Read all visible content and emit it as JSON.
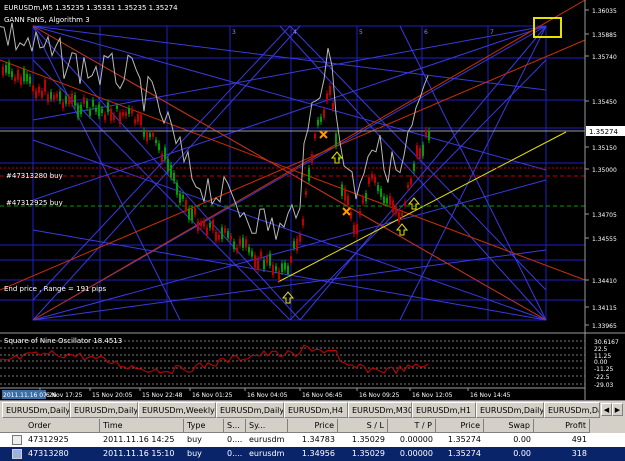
{
  "chart": {
    "header": "EURUSDm,M5  1.35235 1.35331 1.35235 1.35274",
    "indicator_name": "GANN FaNS, Algorithm 3",
    "current_price_label": "1.35274",
    "price_labels": [
      "1.36035",
      "1.35885",
      "1.35740",
      "1.35450",
      "1.35150",
      "1.35000",
      "1.34705",
      "1.34555",
      "1.34410",
      "1.34115",
      "1.33965"
    ],
    "top_numbers": [
      "3",
      "4",
      "5",
      "6",
      "7"
    ],
    "order_labels": [
      "#47313280 buy",
      "#47312925 buy"
    ],
    "end_price_label": "End price , Range = 191 pips",
    "time_labels": [
      "16 Nov 17:25",
      "15 Nov 20:05",
      "15 Nov 22:48",
      "16 Nov 01:25",
      "16 Nov 04:05",
      "16 Nov 06:45",
      "16 Nov 09:25",
      "16 Nov 12:05",
      "16 Nov 14:45"
    ],
    "date_marker": "2011.11.16 07:26",
    "colors": {
      "background": "#000000",
      "grid": "#2020c0",
      "gann_red": "#c83000",
      "trend_yellow": "#e8e000",
      "candle_up": "#00a000",
      "candle_down": "#c00000",
      "oscillator": "#d00000"
    }
  },
  "oscillator": {
    "title": "Square of Nine Oscillator 18.4513",
    "levels": [
      "30.6167",
      "22.5",
      "11.25",
      "0.00",
      "-11.25",
      "-22.5",
      "-29.03"
    ]
  },
  "tabs": {
    "items": [
      "EURUSDm,Daily",
      "EURUSDm,Daily",
      "EURUSDm,Weekly",
      "EURUSDm,Daily",
      "EURUSDm,H4",
      "EURUSDm,M30",
      "EURUSDm,H1",
      "EURUSDm,Daily",
      "EURUSDm,Daily"
    ],
    "prev_icon": "triangle-left-icon",
    "next_icon": "triangle-right-icon"
  },
  "orders": {
    "columns": [
      "Order",
      "Time",
      "Type",
      "S...",
      "Sy...",
      "Price",
      "S / L",
      "T / P",
      "Price",
      "Swap",
      "Profit"
    ],
    "rows": [
      {
        "order": "47312925",
        "time": "2011.11.16 14:25",
        "type": "buy",
        "size": "0....",
        "symbol": "eurusdm",
        "price": "1.34783",
        "sl": "1.35029",
        "tp": "0.00000",
        "cur_price": "1.35274",
        "swap": "0.00",
        "profit": "491"
      },
      {
        "order": "47313280",
        "time": "2011.11.16 15:10",
        "type": "buy",
        "size": "0....",
        "symbol": "eurusdm",
        "price": "1.34956",
        "sl": "1.35029",
        "tp": "0.00000",
        "cur_price": "1.35274",
        "swap": "0.00",
        "profit": "318"
      }
    ]
  }
}
